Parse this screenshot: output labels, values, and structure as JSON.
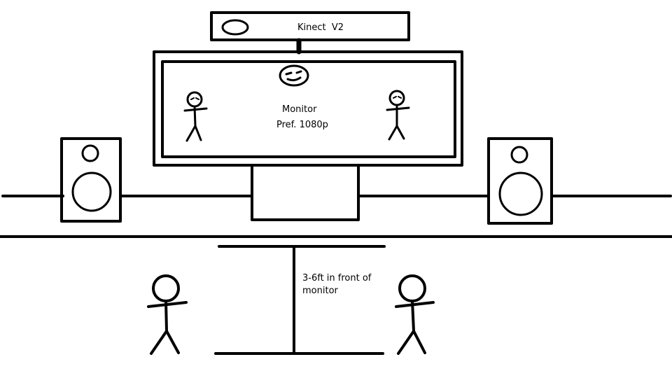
{
  "kinect": {
    "label": "Kinect  V2"
  },
  "monitor": {
    "label": "Monitor",
    "resolution": "Pref. 1080p"
  },
  "distance": {
    "line1": "3-6ft in front of",
    "line2": "monitor"
  },
  "colors": {
    "ink": "#000000",
    "background": "#ffffff"
  }
}
